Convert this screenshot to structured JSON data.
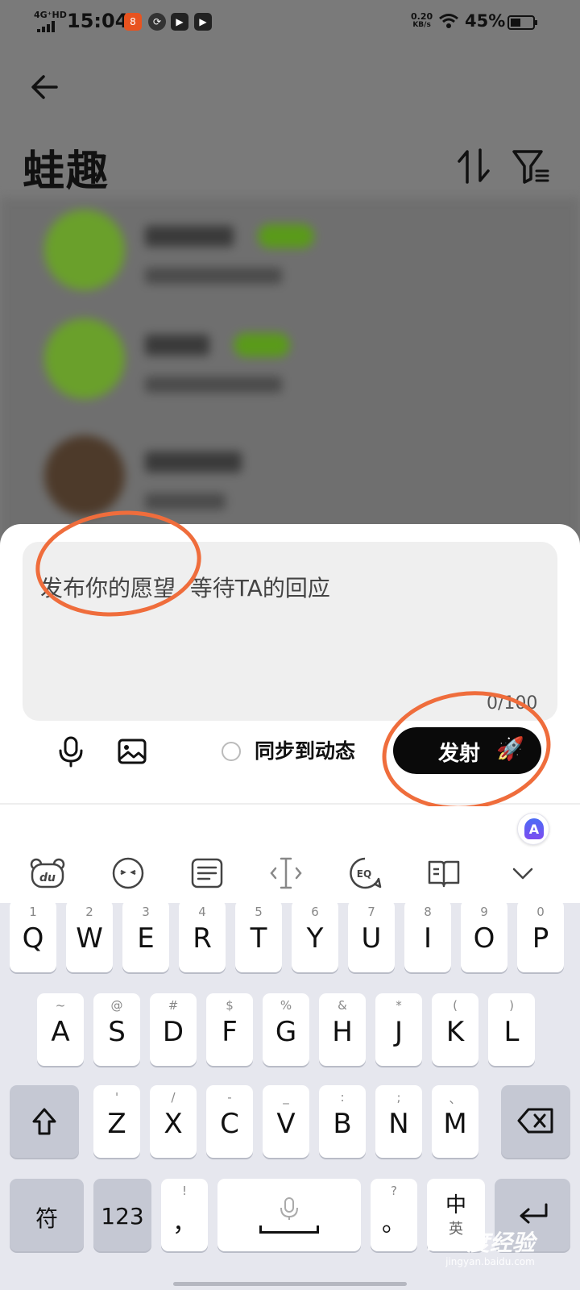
{
  "status_bar": {
    "network": "4G⁺HD",
    "time": "15:04",
    "speed_value": "0.20",
    "speed_unit": "KB/s",
    "battery": "45%"
  },
  "header": {
    "title": "蛙趣",
    "back_icon": "arrow-left-icon",
    "sort_icon": "sort-arrows-icon",
    "filter_icon": "filter-icon"
  },
  "compose": {
    "placeholder": "发布你的愿望  等待TA的回应",
    "counter": "0/100",
    "sync_label": "同步到动态",
    "fire_label": "发射",
    "fire_icon": "🚀"
  },
  "keyboard": {
    "toolbar_icons": [
      "bear-du-icon",
      "emoji-icon",
      "keyboard-layout-icon",
      "cursor-icon",
      "eq-icon",
      "book-icon",
      "chevron-down-icon"
    ],
    "row1": [
      {
        "hint": "1",
        "key": "Q"
      },
      {
        "hint": "2",
        "key": "W"
      },
      {
        "hint": "3",
        "key": "E"
      },
      {
        "hint": "4",
        "key": "R"
      },
      {
        "hint": "5",
        "key": "T"
      },
      {
        "hint": "6",
        "key": "Y"
      },
      {
        "hint": "7",
        "key": "U"
      },
      {
        "hint": "8",
        "key": "I"
      },
      {
        "hint": "9",
        "key": "O"
      },
      {
        "hint": "0",
        "key": "P"
      }
    ],
    "row2": [
      {
        "hint": "~",
        "key": "A"
      },
      {
        "hint": "@",
        "key": "S"
      },
      {
        "hint": "#",
        "key": "D"
      },
      {
        "hint": "$",
        "key": "F"
      },
      {
        "hint": "%",
        "key": "G"
      },
      {
        "hint": "&",
        "key": "H"
      },
      {
        "hint": "*",
        "key": "J"
      },
      {
        "hint": "(",
        "key": "K"
      },
      {
        "hint": ")",
        "key": "L"
      }
    ],
    "row3": [
      {
        "hint": "'",
        "key": "Z"
      },
      {
        "hint": "/",
        "key": "X"
      },
      {
        "hint": "-",
        "key": "C"
      },
      {
        "hint": "_",
        "key": "V"
      },
      {
        "hint": ":",
        "key": "B"
      },
      {
        "hint": ";",
        "key": "N"
      },
      {
        "hint": "、",
        "key": "M"
      }
    ],
    "symbols_label": "符",
    "numbers_label": "123",
    "comma_hint": "!",
    "comma": "，",
    "period_hint": "?",
    "period": "。",
    "lang_label": "中",
    "lang_sub": "英",
    "shift_icon": "shift-arrow-icon",
    "delete_icon": "backspace-icon",
    "enter_icon": "enter-icon",
    "space_icon": "mic-small-icon"
  },
  "watermark": {
    "logo": "Bai度经验",
    "url": "jingyan.baidu.com"
  },
  "annotation_color": "#ef6d3c"
}
